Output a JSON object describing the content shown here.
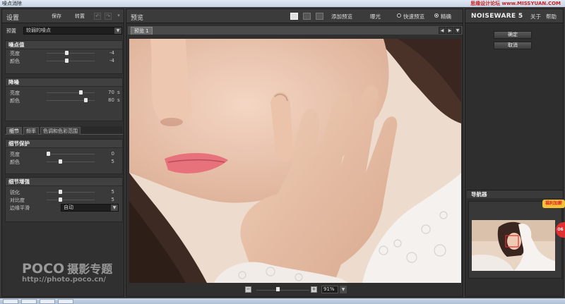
{
  "window": {
    "title": "噪点消除"
  },
  "watermark_top": "思缘设计论坛 www.MISSYUAN.COM",
  "left": {
    "title": "设置",
    "save": "保存",
    "convert": "转置",
    "undo_icon": "undo-icon",
    "redo_icon": "redo-icon",
    "preset_label": "预置",
    "preset_value": "较弱的噪点",
    "noise_level": {
      "title": "噪点值",
      "rows": [
        {
          "label": "亮度",
          "value": "-4",
          "unit": "",
          "level": 0.4
        },
        {
          "label": "颜色",
          "value": "-4",
          "unit": "",
          "level": 0.4
        }
      ]
    },
    "noise_reduction": {
      "title": "降噪",
      "rows": [
        {
          "label": "亮度",
          "value": "70",
          "unit": "s",
          "level": 0.7
        },
        {
          "label": "颜色",
          "value": "80",
          "unit": "s",
          "level": 0.8
        }
      ]
    },
    "tabs": [
      "细节",
      "频率",
      "色调和色彩范围"
    ],
    "detail_protect": {
      "title": "细节保护",
      "rows": [
        {
          "label": "亮度",
          "value": "0",
          "unit": "",
          "level": 0.0
        },
        {
          "label": "颜色",
          "value": "5",
          "unit": "",
          "level": 0.25
        }
      ]
    },
    "detail_enhance": {
      "title": "细节增强",
      "rows": [
        {
          "label": "锐化",
          "value": "5",
          "unit": "",
          "level": 0.25
        },
        {
          "label": "对比度",
          "value": "5",
          "unit": "",
          "level": 0.25
        }
      ],
      "edge_label": "边缘平滑",
      "edge_value": "自动"
    },
    "logo_main": "POCO",
    "logo_cn": "摄影专题",
    "logo_url": "http://photo.poco.cn/"
  },
  "center": {
    "title": "预览",
    "add_preview": "添加预览",
    "exposure": "曝光",
    "fast_preview": "快速预览",
    "precise": "精确",
    "preview_tab": "预览 1",
    "zoom": "91%",
    "zoom_level": 0.4
  },
  "right": {
    "brand": "NOISEWARE 5",
    "about": "关于",
    "help": "帮助",
    "ok": "确定",
    "cancel": "取消",
    "navigator": "导航器",
    "badge": "福利加薪",
    "badge2": "06"
  },
  "colors": {
    "accent": "#f6c13a",
    "panel": "#303030",
    "selection": "#e03030"
  }
}
